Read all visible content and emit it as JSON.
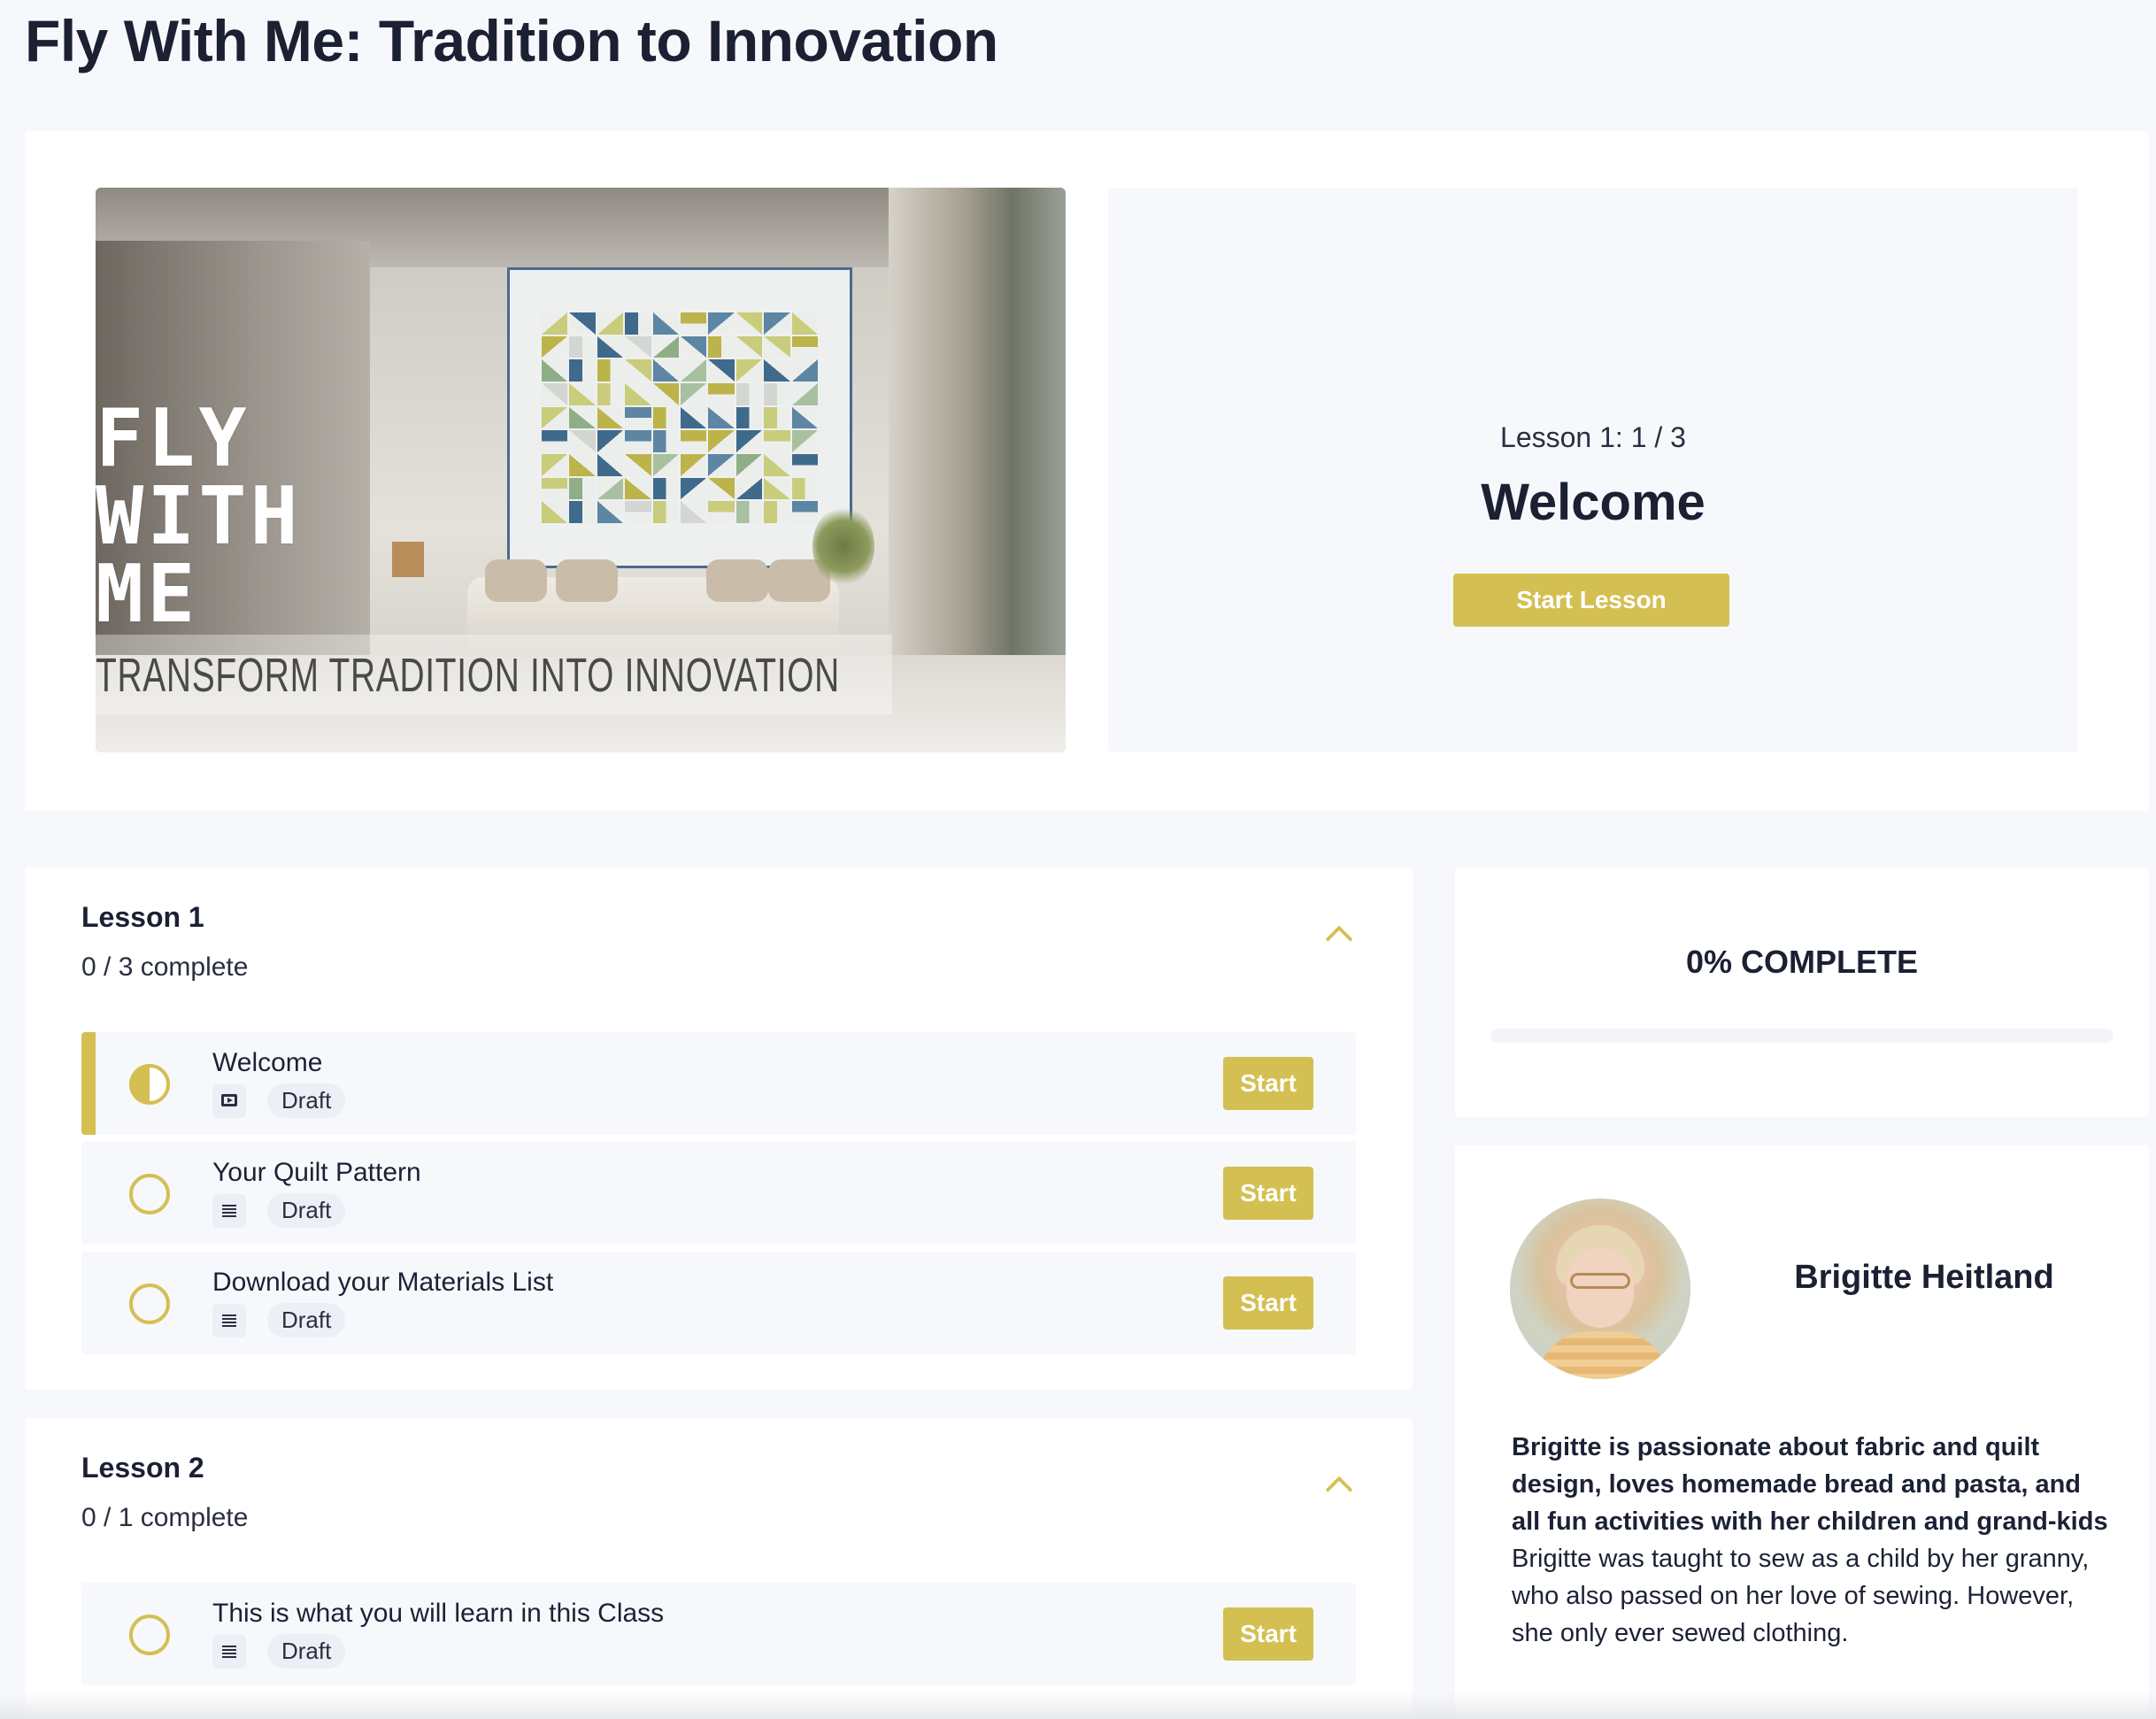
{
  "page": {
    "title": "Fly With Me: Tradition to Innovation"
  },
  "hero": {
    "image": {
      "line1": "FLY",
      "line2": "WITH",
      "line3": "ME",
      "tagline": "TRANSFORM TRADITION INTO INNOVATION"
    },
    "counter": "Lesson 1: 1 / 3",
    "lesson_title": "Welcome",
    "button_label": "Start Lesson"
  },
  "lessons": [
    {
      "heading": "Lesson 1",
      "progress": "0 / 3 complete",
      "items": [
        {
          "title": "Welcome",
          "type_icon": "video-icon",
          "status_label": "Draft",
          "button_label": "Start",
          "state": "in-progress"
        },
        {
          "title": "Your Quilt Pattern",
          "type_icon": "text-icon",
          "status_label": "Draft",
          "button_label": "Start",
          "state": "not-started"
        },
        {
          "title": "Download your Materials List",
          "type_icon": "text-icon",
          "status_label": "Draft",
          "button_label": "Start",
          "state": "not-started"
        }
      ]
    },
    {
      "heading": "Lesson 2",
      "progress": "0 / 1 complete",
      "items": [
        {
          "title": "This is what you will learn in this Class",
          "type_icon": "text-icon",
          "status_label": "Draft",
          "button_label": "Start",
          "state": "not-started"
        }
      ]
    }
  ],
  "course_progress": {
    "label": "0% COMPLETE",
    "fraction": 0
  },
  "author": {
    "name": "Brigitte Heitland",
    "bio_bold": "Brigitte is passionate about fabric and quilt design, loves homemade bread and pasta, and all fun activities with her children and grand-kids",
    "bio_text": "Brigitte was taught to sew as a child by her granny, who also passed on her love of sewing. However, she only ever sewed clothing."
  },
  "colors": {
    "accent": "#d4bf52",
    "page_background": "#f6f8fc",
    "heading_text": "#1b2033"
  }
}
